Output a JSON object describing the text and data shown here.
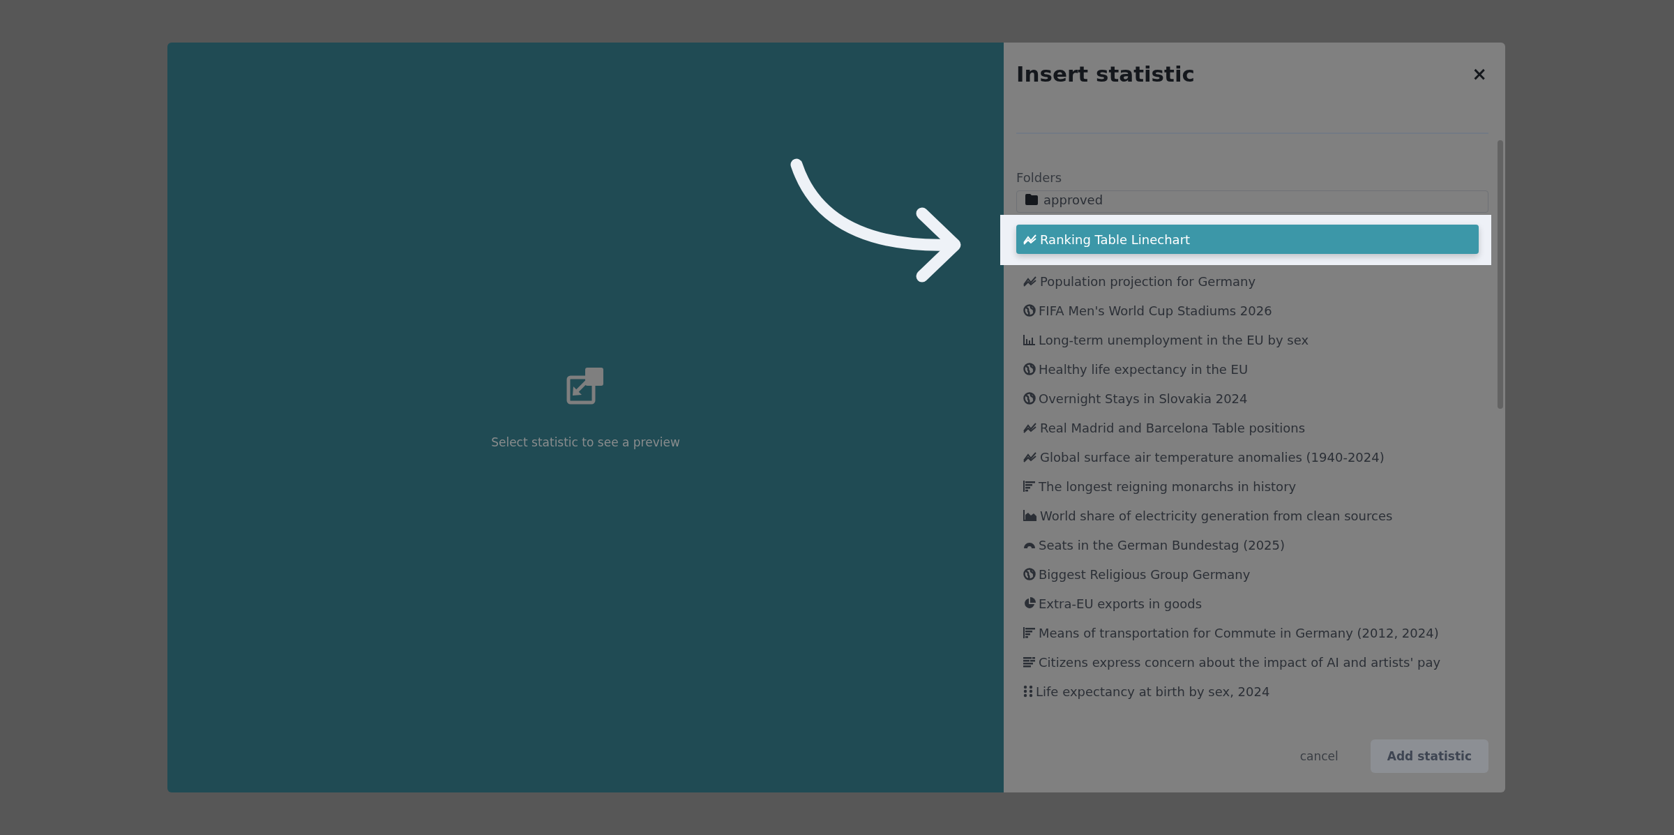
{
  "dialog": {
    "title": "Insert statistic",
    "close": "×"
  },
  "preview": {
    "message": "Select statistic to see a preview"
  },
  "folders": {
    "label": "Folders",
    "value": "approved"
  },
  "statistics": [
    {
      "title": "Ranking Table Linechart",
      "kind": "line",
      "selected": true
    },
    {
      "title": "Population projection for Germany",
      "kind": "line",
      "selected": false
    },
    {
      "title": "FIFA Men's World Cup Stadiums 2026",
      "kind": "globe",
      "selected": false
    },
    {
      "title": "Long-term unemployment in the EU by sex",
      "kind": "column",
      "selected": false
    },
    {
      "title": "Healthy life expectancy in the EU",
      "kind": "globe",
      "selected": false
    },
    {
      "title": "Overnight Stays in Slovakia 2024",
      "kind": "globe",
      "selected": false
    },
    {
      "title": "Real Madrid and Barcelona Table positions",
      "kind": "line",
      "selected": false
    },
    {
      "title": "Global surface air temperature anomalies (1940-2024)",
      "kind": "line",
      "selected": false
    },
    {
      "title": "The longest reigning monarchs in history",
      "kind": "bar",
      "selected": false
    },
    {
      "title": "World share of electricity generation from clean sources",
      "kind": "area",
      "selected": false
    },
    {
      "title": "Seats in the German Bundestag (2025)",
      "kind": "arc",
      "selected": false
    },
    {
      "title": "Biggest Religious Group Germany",
      "kind": "globe",
      "selected": false
    },
    {
      "title": "Extra-EU exports in goods",
      "kind": "pie",
      "selected": false
    },
    {
      "title": "Means of transportation for Commute in Germany (2012, 2024)",
      "kind": "bar",
      "selected": false
    },
    {
      "title": "Citizens express concern about the impact of AI and artists' pay",
      "kind": "stacked",
      "selected": false
    },
    {
      "title": "Life expectancy at birth by sex, 2024",
      "kind": "dots",
      "selected": false
    }
  ],
  "buttons": {
    "cancel": "cancel",
    "add": "Add statistic",
    "add_disabled": true
  }
}
